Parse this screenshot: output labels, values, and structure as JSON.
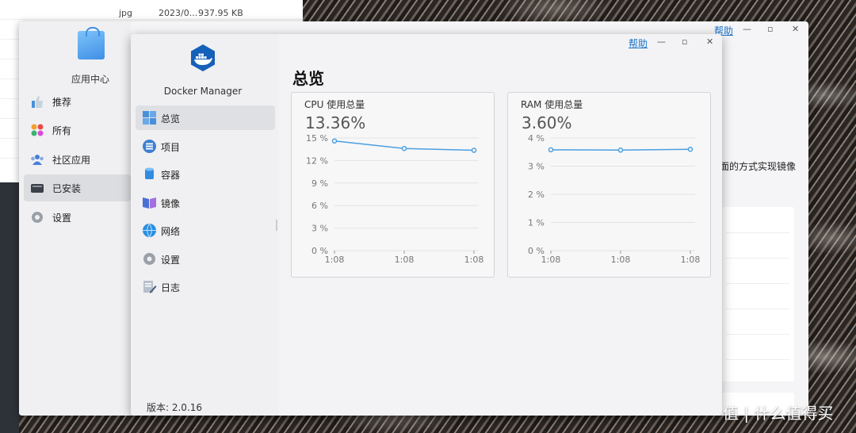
{
  "file_list": {
    "rows": [
      {
        "ext": "jpg",
        "date": "2023/0...",
        "size": "937.95 KB"
      }
    ]
  },
  "app_center": {
    "title": "应用中心",
    "help_label": "帮助",
    "nav": [
      {
        "label": "推荐",
        "icon": "thumbs-up-icon"
      },
      {
        "label": "所有",
        "icon": "grid-apps-icon"
      },
      {
        "label": "社区应用",
        "icon": "community-icon"
      },
      {
        "label": "已安装",
        "icon": "installed-drive-icon",
        "active": true
      },
      {
        "label": "设置",
        "icon": "gear-icon"
      }
    ],
    "partial_text": "面的方式实现镜像"
  },
  "docker": {
    "app_name": "Docker Manager",
    "help_label": "帮助",
    "heading": "总览",
    "version_label": "版本: 2.0.16",
    "nav": [
      {
        "label": "总览",
        "icon": "overview-grid-icon",
        "active": true
      },
      {
        "label": "项目",
        "icon": "project-list-icon"
      },
      {
        "label": "容器",
        "icon": "container-cylinder-icon"
      },
      {
        "label": "镜像",
        "icon": "image-book-icon"
      },
      {
        "label": "网络",
        "icon": "network-globe-icon"
      },
      {
        "label": "设置",
        "icon": "gear-icon"
      },
      {
        "label": "日志",
        "icon": "log-edit-icon"
      }
    ],
    "cpu": {
      "title": "CPU 使用总量",
      "value": "13.36%"
    },
    "ram": {
      "title": "RAM 使用总量",
      "value": "3.60%"
    }
  },
  "watermark": "值 | 什么值得买",
  "colors": {
    "accent": "#1a73c8",
    "line": "#4a9fe0"
  },
  "chart_data": [
    {
      "type": "line",
      "title": "CPU 使用总量",
      "x": [
        "1:08",
        "1:08",
        "1:08"
      ],
      "series": [
        {
          "values": [
            14.6,
            13.6,
            13.36
          ]
        }
      ],
      "ylim": [
        0,
        15
      ],
      "yticks": [
        "0 %",
        "3 %",
        "6 %",
        "9 %",
        "12 %",
        "15 %"
      ],
      "ytick_values": [
        0,
        3,
        6,
        9,
        12,
        15
      ],
      "grid": true
    },
    {
      "type": "line",
      "title": "RAM 使用总量",
      "x": [
        "1:08",
        "1:08",
        "1:08"
      ],
      "series": [
        {
          "values": [
            3.58,
            3.57,
            3.6
          ]
        }
      ],
      "ylim": [
        0,
        4
      ],
      "yticks": [
        "0 %",
        "1 %",
        "2 %",
        "3 %",
        "4 %"
      ],
      "ytick_values": [
        0,
        1,
        2,
        3,
        4
      ],
      "grid": true
    }
  ]
}
